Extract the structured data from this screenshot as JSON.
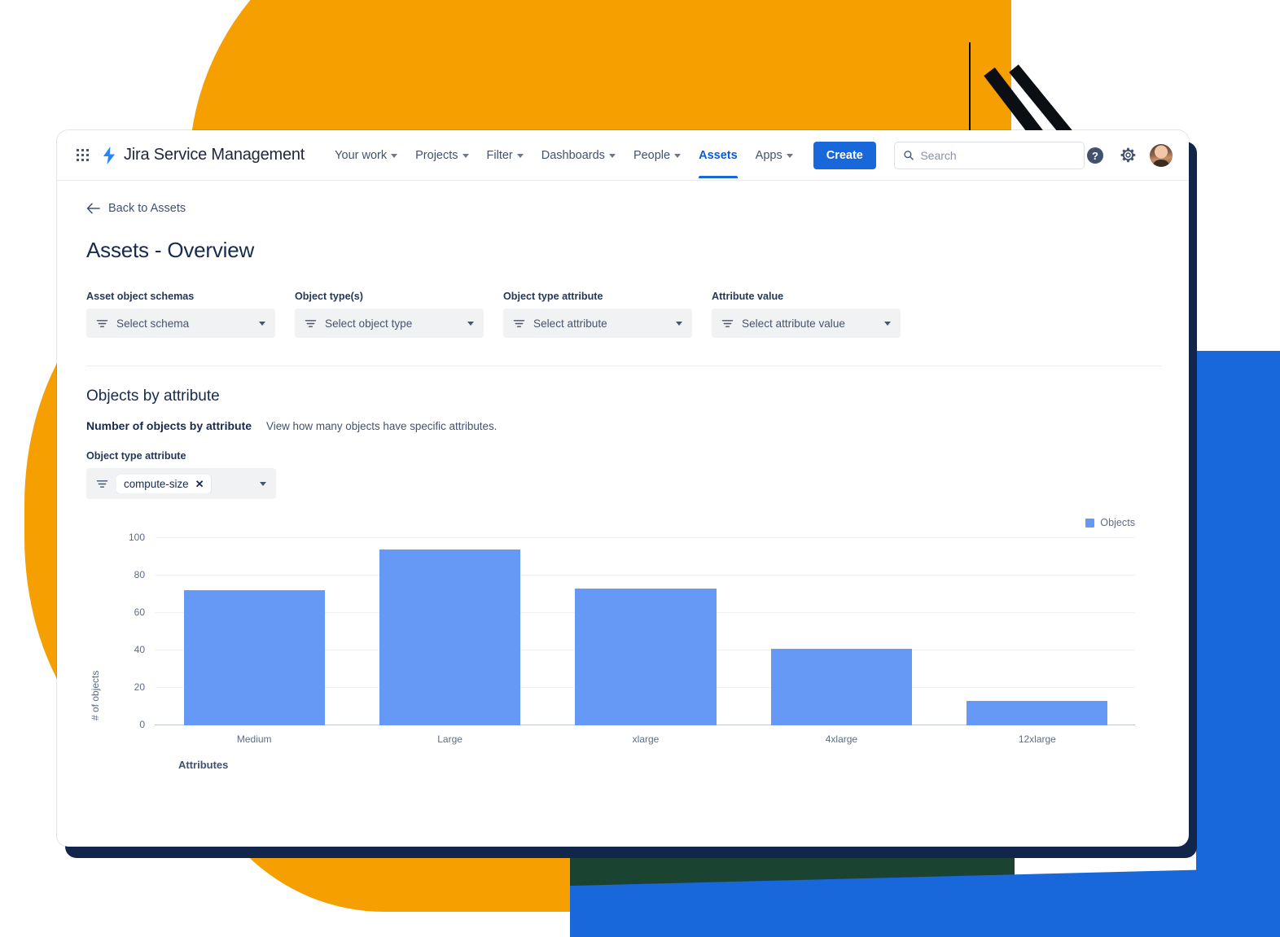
{
  "nav": {
    "app_switcher_icon": "grid-apps-icon",
    "brand_icon": "jira-bolt-icon",
    "brand": "Jira Service Management",
    "items": [
      {
        "label": "Your work",
        "has_caret": true,
        "active": false
      },
      {
        "label": "Projects",
        "has_caret": true,
        "active": false
      },
      {
        "label": "Filter",
        "has_caret": true,
        "active": false
      },
      {
        "label": "Dashboards",
        "has_caret": true,
        "active": false
      },
      {
        "label": "People",
        "has_caret": true,
        "active": false
      },
      {
        "label": "Assets",
        "has_caret": false,
        "active": true
      },
      {
        "label": "Apps",
        "has_caret": true,
        "active": false
      }
    ],
    "create_label": "Create",
    "search_placeholder": "Search",
    "search_value": "",
    "search_icon": "search-icon",
    "help_icon": "help-circle-icon",
    "settings_icon": "gear-icon",
    "avatar_icon": "user-avatar"
  },
  "page": {
    "back_label": "Back to Assets",
    "back_icon": "arrow-left-icon",
    "title": "Assets - Overview"
  },
  "filters": [
    {
      "label": "Asset object schemas",
      "placeholder": "Select schema",
      "icon": "filter-icon"
    },
    {
      "label": "Object type(s)",
      "placeholder": "Select object type",
      "icon": "filter-icon"
    },
    {
      "label": "Object type attribute",
      "placeholder": "Select attribute",
      "icon": "filter-icon"
    },
    {
      "label": "Attribute value",
      "placeholder": "Select attribute value",
      "icon": "filter-icon"
    }
  ],
  "section": {
    "title": "Objects by attribute",
    "sub_title": "Number of objects by attribute",
    "sub_desc": "View how many objects have specific attributes.",
    "attr_label": "Object type attribute",
    "attr_icon": "filter-icon",
    "attr_chip": "compute-size",
    "attr_chip_remove": "✕"
  },
  "colors": {
    "bar": "#6699F5",
    "accent_blue": "#1868DB",
    "text_dark": "#182A4E",
    "deco_orange": "#F5A000",
    "deco_green": "#1B4332",
    "card_shadow": "#12264B"
  },
  "chart_data": {
    "type": "bar",
    "title": "Number of objects by attribute",
    "categories": [
      "Medium",
      "Large",
      "xlarge",
      "4xlarge",
      "12xlarge"
    ],
    "values": [
      72,
      94,
      73,
      41,
      13
    ],
    "series": [
      {
        "name": "Objects",
        "values": [
          72,
          94,
          73,
          41,
          13
        ]
      }
    ],
    "xlabel": "Attributes",
    "ylabel": "# of objects",
    "ylim": [
      0,
      100
    ],
    "yticks": [
      100,
      80,
      60,
      40,
      20,
      0
    ],
    "grid": true,
    "legend": [
      "Objects"
    ],
    "legend_position": "top-right"
  }
}
